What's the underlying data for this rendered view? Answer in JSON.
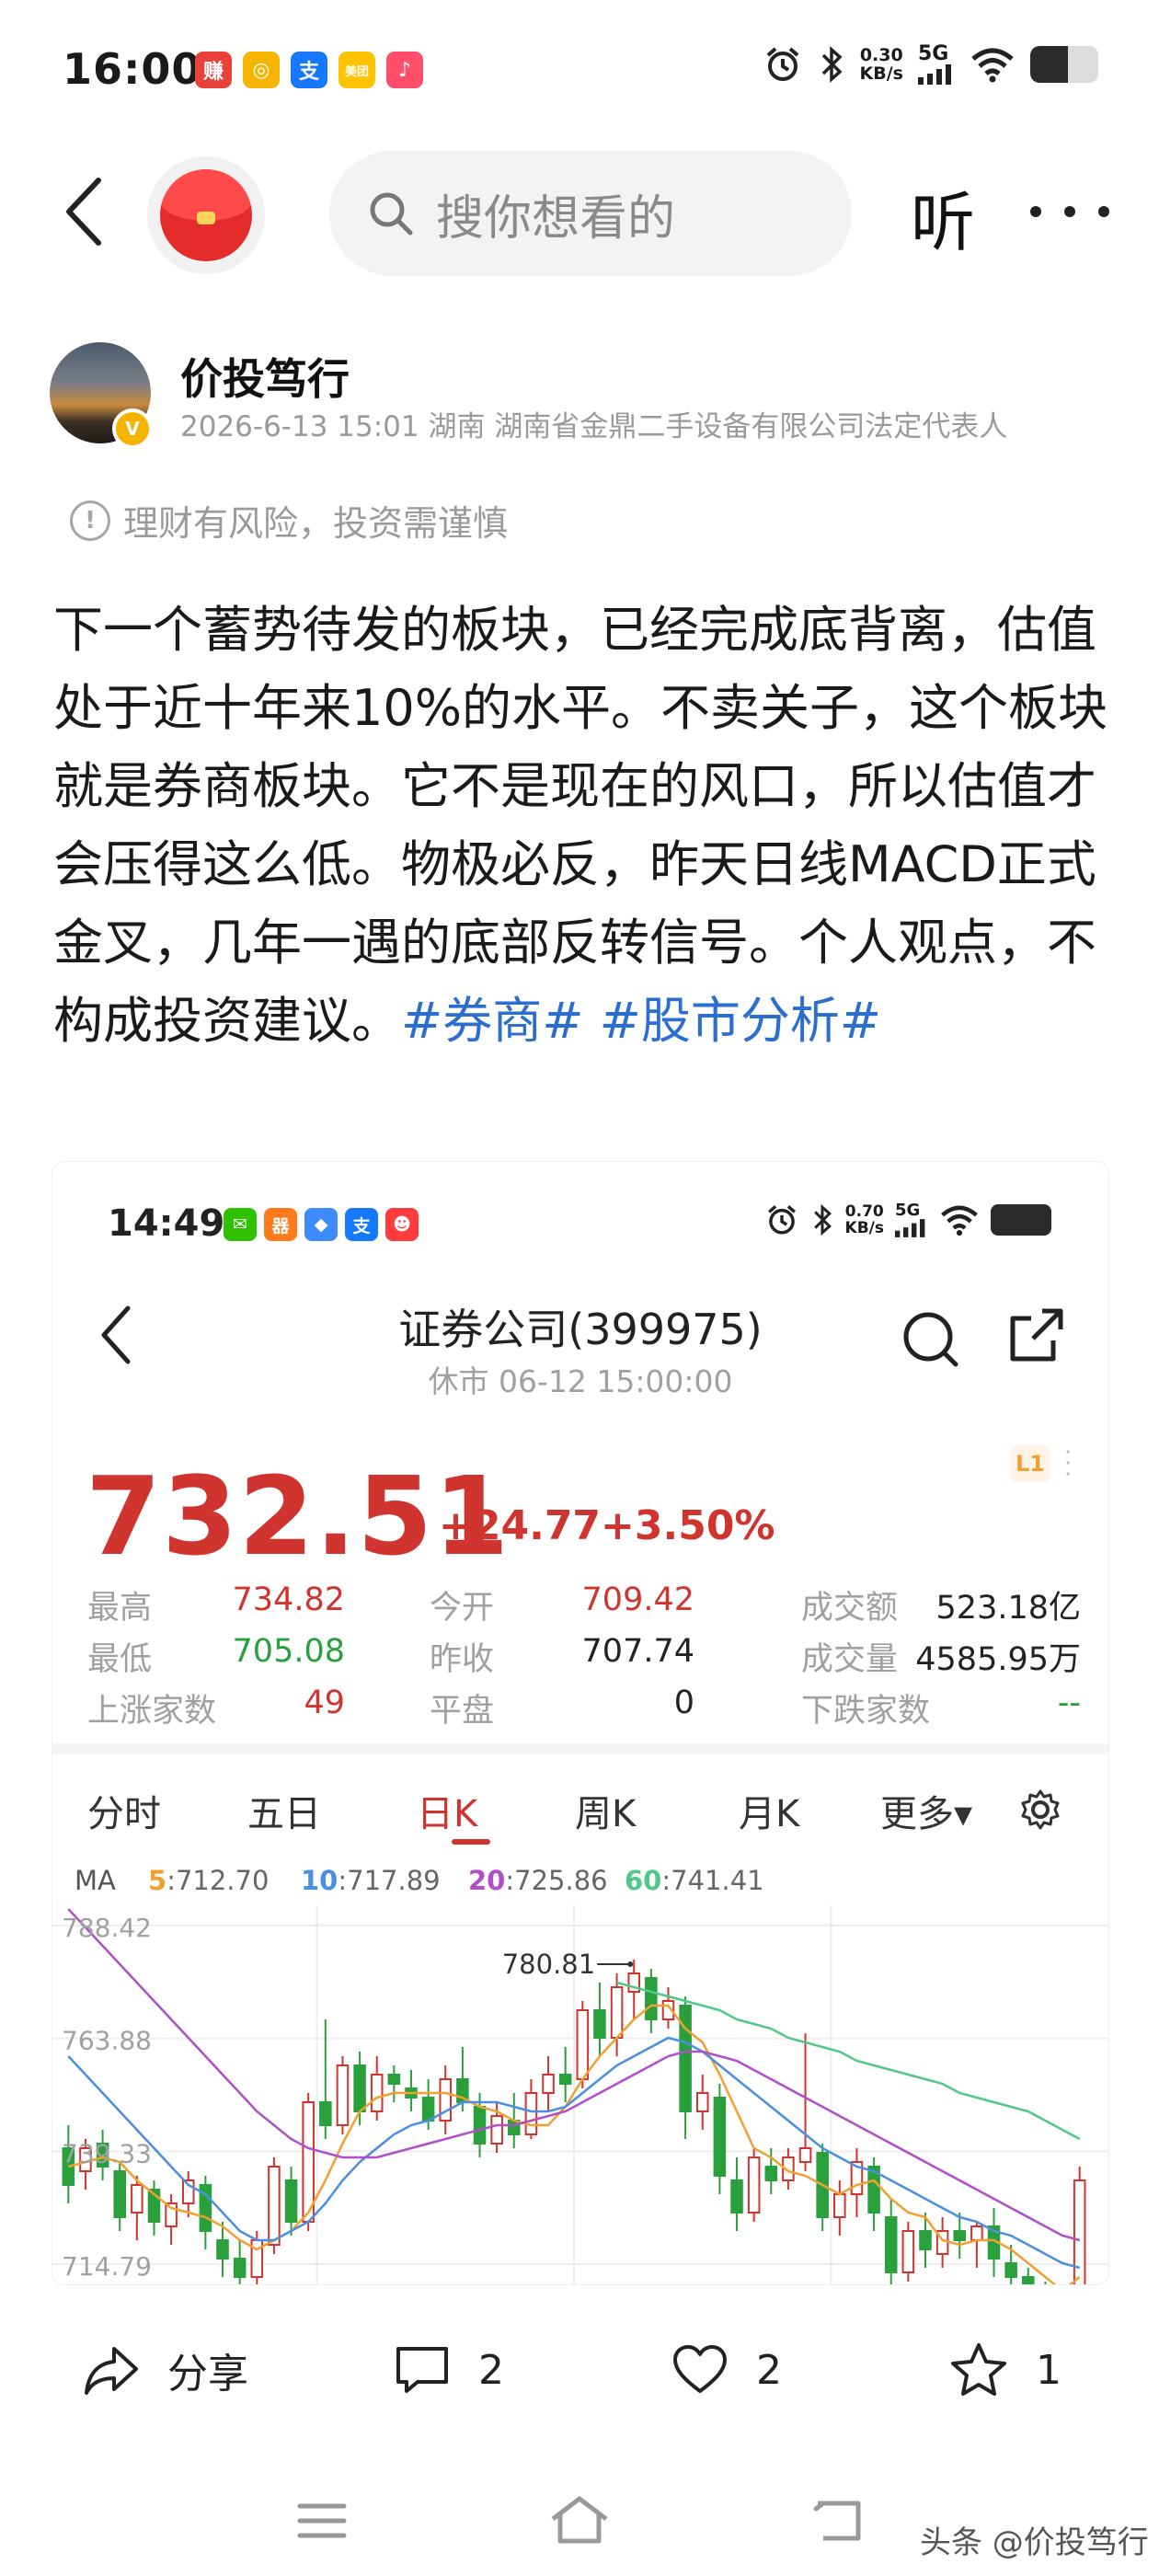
{
  "status_bar": {
    "time": "16:00",
    "apps": [
      {
        "name": "earn-app-icon",
        "glyph": "赚",
        "color": "#e8403a"
      },
      {
        "name": "coin-app-icon",
        "glyph": "◎",
        "color": "#f5b400"
      },
      {
        "name": "alipay-app-icon",
        "glyph": "支",
        "color": "#1677ff"
      },
      {
        "name": "meituan-app-icon",
        "glyph": "美团",
        "color": "#ffc300"
      },
      {
        "name": "music-app-icon",
        "glyph": "♪",
        "color": "#ff4d6a"
      }
    ],
    "net_speed": "0.30",
    "net_unit": "KB/s",
    "network": "5G",
    "battery_level": 0.55
  },
  "nav": {
    "search_placeholder": "搜你想看的",
    "listen_label": "听"
  },
  "author": {
    "name": "价投笃行",
    "meta": "2026-6-13 15:01 湖南 湖南省金鼎二手设备有限公司法定代表人",
    "badge": "V"
  },
  "risk_notice": {
    "icon_glyph": "!",
    "text": "理财有风险，投资需谨慎"
  },
  "post": {
    "body": "下一个蓄势待发的板块，已经完成底背离，估值处于近十年来10%的水平。不卖关子，这个板块就是券商板块。它不是现在的风口，所以估值才会压得这么低。物极必反，昨天日线MACD正式金叉，几年一遇的底部反转信号。个人观点，不构成投资建议。",
    "tags": [
      "#券商#",
      " #股市分析#"
    ]
  },
  "embedded": {
    "status_time": "14:49",
    "apps": [
      {
        "name": "wechat-app-icon",
        "glyph": "✉",
        "color": "#2dc100"
      },
      {
        "name": "orange-app-icon",
        "glyph": "器",
        "color": "#ff7a1a"
      },
      {
        "name": "blue-app-icon",
        "glyph": "◆",
        "color": "#3d8bff"
      },
      {
        "name": "alipay-app-icon",
        "glyph": "支",
        "color": "#1677ff"
      },
      {
        "name": "red-app-icon",
        "glyph": "☻",
        "color": "#ff3b3b"
      }
    ],
    "net_speed": "0.70",
    "net_unit": "KB/s",
    "network": "5G",
    "title": "证券公司(399975)",
    "subtitle": "休市  06-12  15:00:00",
    "price": "732.51",
    "change": "+24.77",
    "change_pct": "+3.50%",
    "level_badge": "L1",
    "stats": [
      [
        {
          "label": "最高",
          "value": "734.82",
          "tone": "red"
        },
        {
          "label": "今开",
          "value": "709.42",
          "tone": "red"
        },
        {
          "label": "成交额",
          "value": "523.18亿",
          "tone": "dark"
        }
      ],
      [
        {
          "label": "最低",
          "value": "705.08",
          "tone": "green"
        },
        {
          "label": "昨收",
          "value": "707.74",
          "tone": "dark"
        },
        {
          "label": "成交量",
          "value": "4585.95万",
          "tone": "dark"
        }
      ],
      [
        {
          "label": "上涨家数",
          "value": "49",
          "tone": "red"
        },
        {
          "label": "平盘",
          "value": "0",
          "tone": "dark"
        },
        {
          "label": "下跌家数",
          "value": "--",
          "tone": "green"
        }
      ]
    ],
    "tabs": [
      "分时",
      "五日",
      "日K",
      "周K",
      "月K",
      "更多▾"
    ],
    "active_tab": 2,
    "ma": {
      "label": "MA",
      "items": [
        {
          "key": "5",
          "value": ":712.70",
          "color": "#f0a030"
        },
        {
          "key": "10",
          "value": ":717.89",
          "color": "#4a8fe0"
        },
        {
          "key": "20",
          "value": ":725.86",
          "color": "#b04fc8"
        },
        {
          "key": "60",
          "value": ":741.41",
          "color": "#50c888"
        }
      ]
    }
  },
  "chart_data": {
    "type": "candlestick",
    "y_tick_labels": [
      "788.42",
      "763.88",
      "739.33",
      "714.79"
    ],
    "ylim": [
      710,
      792
    ],
    "annotation": {
      "label": "780.81",
      "value": 780.81,
      "index": 33
    },
    "up_color": "#d0342f",
    "down_color": "#2aa03c",
    "grid": true,
    "candles": [
      [
        740,
        745,
        728,
        732
      ],
      [
        735,
        742,
        731,
        740
      ],
      [
        741,
        744,
        733,
        736
      ],
      [
        735,
        737,
        722,
        725
      ],
      [
        726,
        734,
        720,
        732
      ],
      [
        731,
        733,
        721,
        724
      ],
      [
        723,
        730,
        719,
        728
      ],
      [
        728,
        735,
        725,
        733
      ],
      [
        732,
        734,
        718,
        722
      ],
      [
        720,
        724,
        712,
        716
      ],
      [
        716,
        720,
        708,
        712
      ],
      [
        712,
        722,
        709,
        720
      ],
      [
        719,
        738,
        717,
        736
      ],
      [
        733,
        736,
        721,
        724
      ],
      [
        724,
        752,
        722,
        750
      ],
      [
        750,
        768,
        742,
        745
      ],
      [
        745,
        760,
        743,
        758
      ],
      [
        758,
        761,
        745,
        748
      ],
      [
        748,
        760,
        746,
        756
      ],
      [
        756,
        758,
        750,
        754
      ],
      [
        753,
        757,
        748,
        751
      ],
      [
        751,
        755,
        744,
        746
      ],
      [
        746,
        758,
        743,
        755
      ],
      [
        755,
        762,
        748,
        750
      ],
      [
        749,
        752,
        738,
        741
      ],
      [
        741,
        750,
        739,
        747
      ],
      [
        746,
        752,
        740,
        743
      ],
      [
        743,
        755,
        742,
        752
      ],
      [
        752,
        760,
        748,
        756
      ],
      [
        756,
        762,
        750,
        754
      ],
      [
        755,
        772,
        753,
        770
      ],
      [
        770,
        776,
        760,
        764
      ],
      [
        764,
        778,
        760,
        775
      ],
      [
        774,
        781,
        768,
        778
      ],
      [
        777,
        779,
        765,
        768
      ],
      [
        768,
        775,
        766,
        772
      ],
      [
        771,
        773,
        742,
        748
      ],
      [
        748,
        756,
        744,
        752
      ],
      [
        751,
        754,
        730,
        734
      ],
      [
        733,
        738,
        722,
        726
      ],
      [
        726,
        740,
        724,
        738
      ],
      [
        736,
        740,
        730,
        733
      ],
      [
        733,
        740,
        731,
        738
      ],
      [
        737,
        765,
        735,
        740
      ],
      [
        739,
        741,
        722,
        725
      ],
      [
        725,
        733,
        721,
        730
      ],
      [
        730,
        740,
        725,
        737
      ],
      [
        736,
        738,
        722,
        726
      ],
      [
        725,
        729,
        710,
        713
      ],
      [
        713,
        724,
        711,
        722
      ],
      [
        722,
        726,
        714,
        718
      ],
      [
        717,
        725,
        714,
        722
      ],
      [
        722,
        726,
        716,
        720
      ],
      [
        720,
        724,
        714,
        723
      ],
      [
        723,
        727,
        712,
        716
      ],
      [
        715,
        719,
        710,
        712
      ],
      [
        712,
        714,
        706,
        708
      ],
      [
        708,
        711,
        703,
        706
      ],
      [
        705,
        707,
        700,
        704
      ],
      [
        704,
        736,
        703,
        733
      ]
    ],
    "ma_series": [
      {
        "key": "5",
        "color": "#f0a030",
        "values": [
          736,
          737,
          738,
          737,
          733,
          730,
          727,
          726,
          725,
          723,
          720,
          718,
          720,
          722,
          726,
          733,
          741,
          748,
          751,
          752,
          752,
          752,
          752,
          751,
          749,
          748,
          746,
          745,
          745,
          749,
          755,
          760,
          764,
          768,
          771,
          771,
          766,
          763,
          756,
          748,
          740,
          738,
          735,
          734,
          732,
          730,
          732,
          733,
          729,
          726,
          725,
          720,
          719,
          720,
          720,
          718,
          715,
          712,
          709,
          712
        ]
      },
      {
        "key": "10",
        "color": "#4a8fe0",
        "values": [
          760,
          756,
          752,
          748,
          744,
          740,
          736,
          732,
          730,
          726,
          722,
          720,
          720,
          722,
          724,
          728,
          733,
          737,
          740,
          743,
          745,
          746,
          748,
          750,
          750,
          750,
          749,
          748,
          748,
          749,
          752,
          755,
          758,
          760,
          762,
          764,
          763,
          761,
          758,
          755,
          752,
          749,
          746,
          743,
          740,
          738,
          736,
          735,
          733,
          731,
          729,
          727,
          725,
          724,
          722,
          721,
          719,
          717,
          715,
          714
        ]
      },
      {
        "key": "20",
        "color": "#b04fc8",
        "values": [
          792,
          788,
          784,
          780,
          776,
          772,
          768,
          764,
          760,
          756,
          752,
          748,
          745,
          742,
          740,
          739,
          738,
          738,
          738,
          739,
          740,
          741,
          742,
          743,
          744,
          745,
          745,
          746,
          747,
          748,
          750,
          752,
          754,
          756,
          758,
          760,
          761,
          761,
          760,
          759,
          757,
          755,
          753,
          751,
          749,
          747,
          745,
          743,
          741,
          739,
          737,
          735,
          733,
          731,
          729,
          727,
          725,
          723,
          721,
          720
        ]
      },
      {
        "key": "60",
        "color": "#50c888",
        "values": [
          null,
          null,
          null,
          null,
          null,
          null,
          null,
          null,
          null,
          null,
          null,
          null,
          null,
          null,
          null,
          null,
          null,
          null,
          null,
          null,
          null,
          null,
          null,
          null,
          null,
          null,
          null,
          null,
          null,
          null,
          null,
          null,
          776,
          775,
          774,
          773,
          772,
          771,
          770,
          768,
          767,
          766,
          764,
          763,
          762,
          761,
          759,
          758,
          757,
          756,
          755,
          754,
          752,
          751,
          750,
          749,
          748,
          746,
          744,
          742
        ]
      }
    ]
  },
  "actions": [
    {
      "name": "share-button",
      "icon": "share-icon",
      "label": "分享"
    },
    {
      "name": "comment-button",
      "icon": "comment-icon",
      "label": "2"
    },
    {
      "name": "like-button",
      "icon": "heart-icon",
      "label": "2"
    },
    {
      "name": "favorite-button",
      "icon": "star-icon",
      "label": "1"
    }
  ],
  "watermark": "头条 @价投笃行"
}
